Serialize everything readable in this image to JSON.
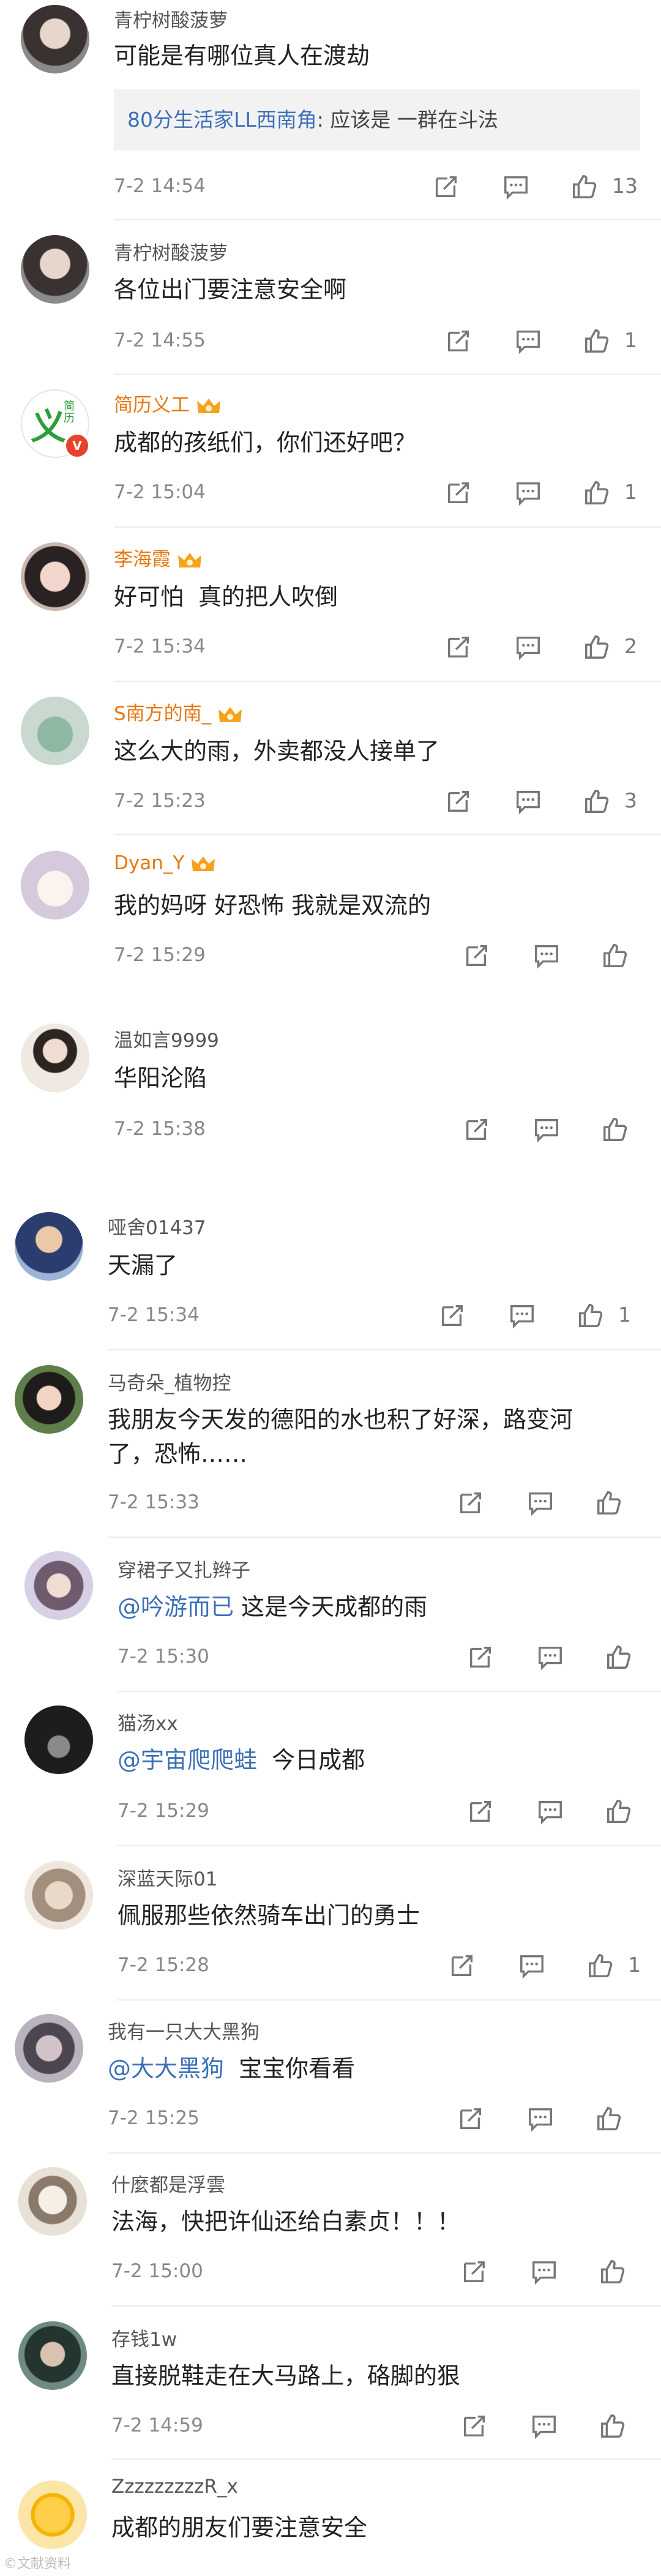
{
  "comments": [
    {
      "user": "青柠树酸菠萝",
      "text": "可能是有哪位真人在渡劫",
      "quote_user": "80分生活家LL西南角",
      "quote_text": "应该是 一群在斗法",
      "time": "7-2 14:54",
      "likes": "13"
    },
    {
      "user": "青柠树酸菠萝",
      "text": "各位出门要注意安全啊",
      "time": "7-2 14:55",
      "likes": "1"
    },
    {
      "user": "简历义工",
      "text": "成都的孩纸们，你们还好吧？",
      "time": "7-2 15:04",
      "likes": "1",
      "avatar_label": "义",
      "avatar_small": "简\n历",
      "verified": "V"
    },
    {
      "user": "李海霞",
      "text": "好可怕  真的把人吹倒",
      "time": "7-2 15:34",
      "likes": "2"
    },
    {
      "user": "S南方的南_",
      "text": "这么大的雨，外卖都没人接单了",
      "time": "7-2 15:23",
      "likes": "3"
    },
    {
      "user": "Dyan_Y",
      "text": "我的妈呀 好恐怖 我就是双流的",
      "time": "7-2 15:29",
      "likes": ""
    },
    {
      "user": "温如言9999",
      "text": "华阳沦陷",
      "time": "7-2 15:38",
      "likes": ""
    },
    {
      "user": "哑舍01437",
      "text": "天漏了",
      "time": "7-2 15:34",
      "likes": "1"
    },
    {
      "user": "马奇朵_植物控",
      "text_line1": "我朋友今天发的德阳的水也积了好深，路变河",
      "text_line2": "了，恐怖……",
      "time": "7-2 15:33",
      "likes": ""
    },
    {
      "user": "穿裙子又扎辫子",
      "mention": "@吟游而已",
      "text": " 这是今天成都的雨",
      "time": "7-2 15:30",
      "likes": ""
    },
    {
      "user": "猫汤xx",
      "mention": "@宇宙爬爬蛙",
      "text": "  今日成都",
      "time": "7-2 15:29",
      "likes": ""
    },
    {
      "user": "深蓝天际01",
      "text": "佩服那些依然骑车出门的勇士",
      "time": "7-2 15:28",
      "likes": "1"
    },
    {
      "user": "我有一只大大黑狗",
      "mention": "@大大黑狗",
      "text": "  宝宝你看看",
      "time": "7-2 15:25",
      "likes": ""
    },
    {
      "user": "什麼都是浮雲",
      "text": "法海，快把许仙还给白素贞！！！",
      "time": "7-2 15:00",
      "likes": ""
    },
    {
      "user": "存钱1w",
      "text": "直接脱鞋走在大马路上，硌脚的狠",
      "time": "7-2 14:59",
      "likes": ""
    },
    {
      "user": "ZzzzzzzzzR_x",
      "text": "成都的朋友们要注意安全",
      "time": "",
      "likes": ""
    }
  ],
  "watermark": "©文献资料",
  "colors": {
    "orange_name": "#e8770e",
    "mention": "#3b70b8",
    "time": "#888888"
  },
  "icons": {
    "repost": "repost-icon",
    "comment": "comment-icon",
    "like": "like-icon",
    "crown": "vip-crown-icon"
  }
}
